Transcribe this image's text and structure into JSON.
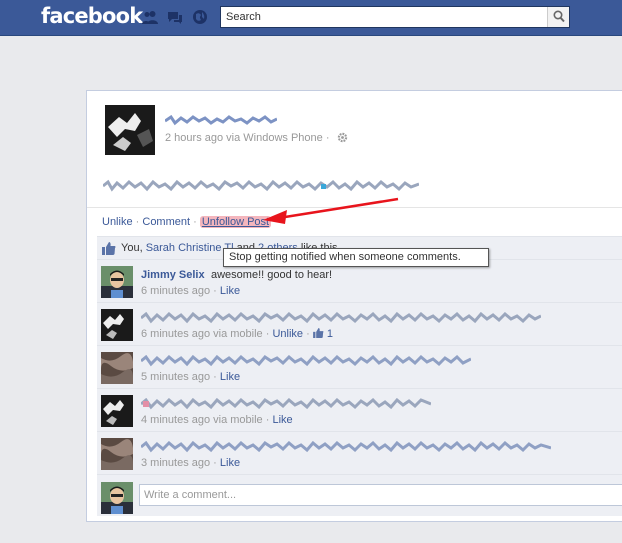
{
  "topbar": {
    "logo": "facebook",
    "search_placeholder": "Search",
    "icons": [
      "friends-icon",
      "messages-icon",
      "notifications-icon",
      "search-icon"
    ],
    "color": "#3b5998"
  },
  "post": {
    "meta": "2 hours ago via Windows Phone",
    "meta_separator": "·",
    "actions": {
      "unlike": "Unlike",
      "comment": "Comment",
      "unfollow": "Unfollow Post",
      "separator": "·"
    },
    "likes": {
      "prefix": "You, ",
      "name": "Sarah Christine",
      "name_tail": " Tl",
      "middle": "and ",
      "others": "2 others",
      "suffix": " like this."
    },
    "tooltip": "Stop getting notified when someone comments."
  },
  "comments": [
    {
      "name": "Jimmy Selix",
      "text": "awesome!! good to hear!",
      "time": "6 minutes ago",
      "like": "Like"
    },
    {
      "time": "6 minutes ago via mobile",
      "unlike": "Unlike",
      "like_count": "1"
    },
    {
      "time": "5 minutes ago",
      "like": "Like"
    },
    {
      "time": "4 minutes ago via mobile",
      "like": "Like"
    },
    {
      "time": "3 minutes ago",
      "like": "Like"
    }
  ],
  "composer": {
    "placeholder": "Write a comment..."
  },
  "colors": {
    "link": "#3b5998",
    "highlight": "#f4b6bd",
    "arrow": "#e8141c",
    "ufi_bg": "#edeff4"
  }
}
